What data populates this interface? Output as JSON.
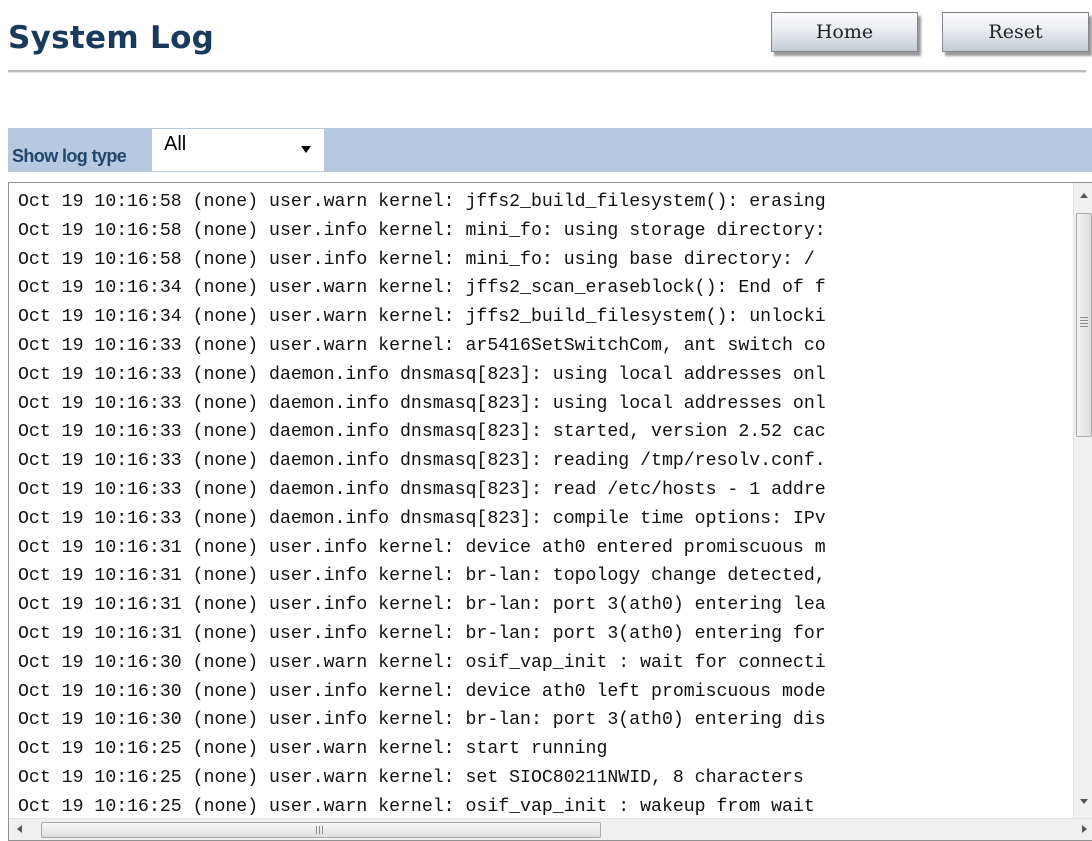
{
  "header": {
    "title": "System Log",
    "home_label": "Home",
    "reset_label": "Reset"
  },
  "filter": {
    "label": "Show log type",
    "selected": "All"
  },
  "log": {
    "lines": [
      "Oct 19 10:16:58 (none) user.warn kernel: jffs2_build_filesystem(): erasing",
      "Oct 19 10:16:58 (none) user.info kernel: mini_fo: using storage directory:",
      "Oct 19 10:16:58 (none) user.info kernel: mini_fo: using base directory: /",
      "Oct 19 10:16:34 (none) user.warn kernel: jffs2_scan_eraseblock(): End of f",
      "Oct 19 10:16:34 (none) user.warn kernel: jffs2_build_filesystem(): unlocki",
      "Oct 19 10:16:33 (none) user.warn kernel: ar5416SetSwitchCom, ant switch co",
      "Oct 19 10:16:33 (none) daemon.info dnsmasq[823]: using local addresses onl",
      "Oct 19 10:16:33 (none) daemon.info dnsmasq[823]: using local addresses onl",
      "Oct 19 10:16:33 (none) daemon.info dnsmasq[823]: started, version 2.52 cac",
      "Oct 19 10:16:33 (none) daemon.info dnsmasq[823]: reading /tmp/resolv.conf.",
      "Oct 19 10:16:33 (none) daemon.info dnsmasq[823]: read /etc/hosts - 1 addre",
      "Oct 19 10:16:33 (none) daemon.info dnsmasq[823]: compile time options: IPv",
      "Oct 19 10:16:31 (none) user.info kernel: device ath0 entered promiscuous m",
      "Oct 19 10:16:31 (none) user.info kernel: br-lan: topology change detected,",
      "Oct 19 10:16:31 (none) user.info kernel: br-lan: port 3(ath0) entering lea",
      "Oct 19 10:16:31 (none) user.info kernel: br-lan: port 3(ath0) entering for",
      "Oct 19 10:16:30 (none) user.warn kernel: osif_vap_init : wait for connecti",
      "Oct 19 10:16:30 (none) user.info kernel: device ath0 left promiscuous mode",
      "Oct 19 10:16:30 (none) user.info kernel: br-lan: port 3(ath0) entering dis",
      "Oct 19 10:16:25 (none) user.warn kernel: start running",
      "Oct 19 10:16:25 (none) user.warn kernel: set SIOC80211NWID, 8 characters",
      "Oct 19 10:16:25 (none) user.warn kernel: osif_vap_init : wakeup from wait"
    ]
  },
  "scrollbar": {
    "h_thumb_label": "III"
  }
}
